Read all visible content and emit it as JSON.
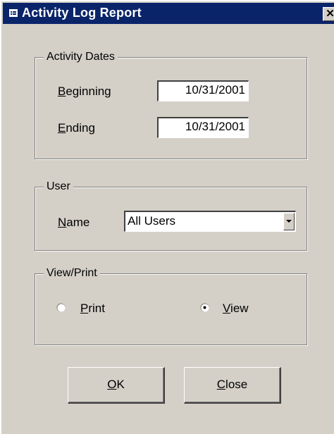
{
  "window": {
    "title": "Activity Log Report",
    "close_glyph": "✕"
  },
  "activity_dates": {
    "legend": "Activity Dates",
    "beginning_label_mnemonic": "B",
    "beginning_label_rest": "eginning",
    "beginning_value": "10/31/2001",
    "ending_label_mnemonic": "E",
    "ending_label_rest": "nding",
    "ending_value": "10/31/2001"
  },
  "user": {
    "legend": "User",
    "name_label_mnemonic": "N",
    "name_label_rest": "ame",
    "name_value": "All Users"
  },
  "view_print": {
    "legend": "View/Print",
    "print_label_mnemonic": "P",
    "print_label_rest": "rint",
    "view_label_mnemonic": "V",
    "view_label_rest": "iew",
    "selected": "View"
  },
  "buttons": {
    "ok_mnemonic": "O",
    "ok_rest": "K",
    "close_mnemonic": "C",
    "close_rest": "lose"
  }
}
